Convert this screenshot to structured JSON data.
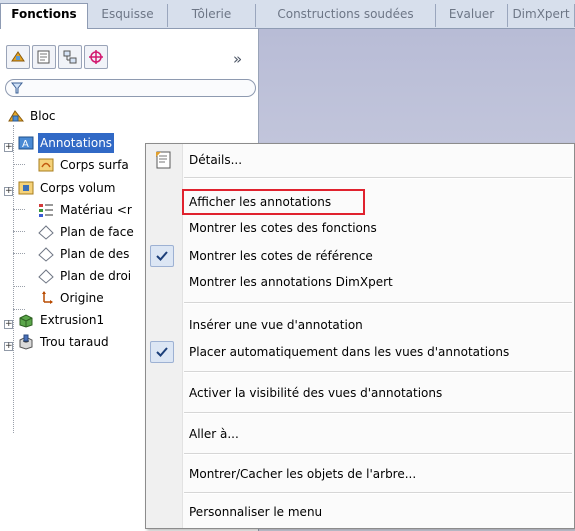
{
  "tabs": [
    "Fonctions",
    "Esquisse",
    "Tôlerie",
    "Constructions soudées",
    "Evaluer",
    "DimXpert"
  ],
  "feature_manager": {
    "more_glyph": "»",
    "tree": [
      {
        "label": "Bloc"
      },
      {
        "label": "Annotations"
      },
      {
        "label": "Corps surfa"
      },
      {
        "label": "Corps volum"
      },
      {
        "label": "Matériau <r"
      },
      {
        "label": "Plan de face"
      },
      {
        "label": "Plan de des"
      },
      {
        "label": "Plan de droi"
      },
      {
        "label": "Origine"
      },
      {
        "label": "Extrusion1"
      },
      {
        "label": "Trou taraud"
      }
    ]
  },
  "context_menu": {
    "items": [
      {
        "label": "Détails...",
        "icon": "details-icon"
      },
      {
        "label": "Afficher les annotations",
        "highlighted": true
      },
      {
        "label": "Montrer les cotes des fonctions"
      },
      {
        "label": "Montrer les cotes de référence",
        "checked": true
      },
      {
        "label": "Montrer les annotations DimXpert"
      },
      {
        "label": "Insérer une vue d'annotation"
      },
      {
        "label": "Placer automatiquement dans les vues d'annotations",
        "checked": true
      },
      {
        "label": "Activer la visibilité des vues d'annotations"
      },
      {
        "label": "Aller à..."
      },
      {
        "label": "Montrer/Cacher les objets de l'arbre..."
      },
      {
        "label": "Personnaliser le menu"
      }
    ]
  },
  "colors": {
    "selection": "#3169c6",
    "highlight_box": "#e0222e",
    "graphics_bg": "#c9ccdf"
  }
}
